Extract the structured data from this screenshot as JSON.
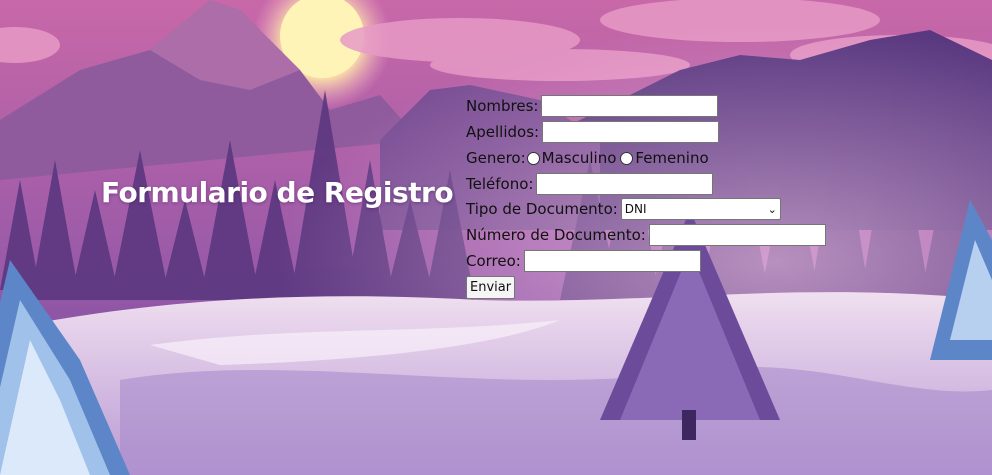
{
  "page": {
    "title": "Formulario de Registro"
  },
  "form": {
    "nombres_label": "Nombres:",
    "nombres_value": "",
    "apellidos_label": "Apellidos:",
    "apellidos_value": "",
    "genero_label": "Genero:",
    "genero_options": [
      "Masculino",
      "Femenino"
    ],
    "telefono_label": "Teléfono:",
    "telefono_value": "",
    "tipo_documento_label": "Tipo de Documento:",
    "tipo_documento_selected": "DNI",
    "numero_documento_label": "Número de Documento:",
    "numero_documento_value": "",
    "correo_label": "Correo:",
    "correo_value": "",
    "submit_label": "Enviar"
  },
  "colors": {
    "sky_top": "#c66aa6",
    "sky_bottom": "#7b4ea3",
    "sun": "#fff6c0",
    "snow": "#ecd9ee",
    "tree_dark": "#4a2c6b"
  }
}
